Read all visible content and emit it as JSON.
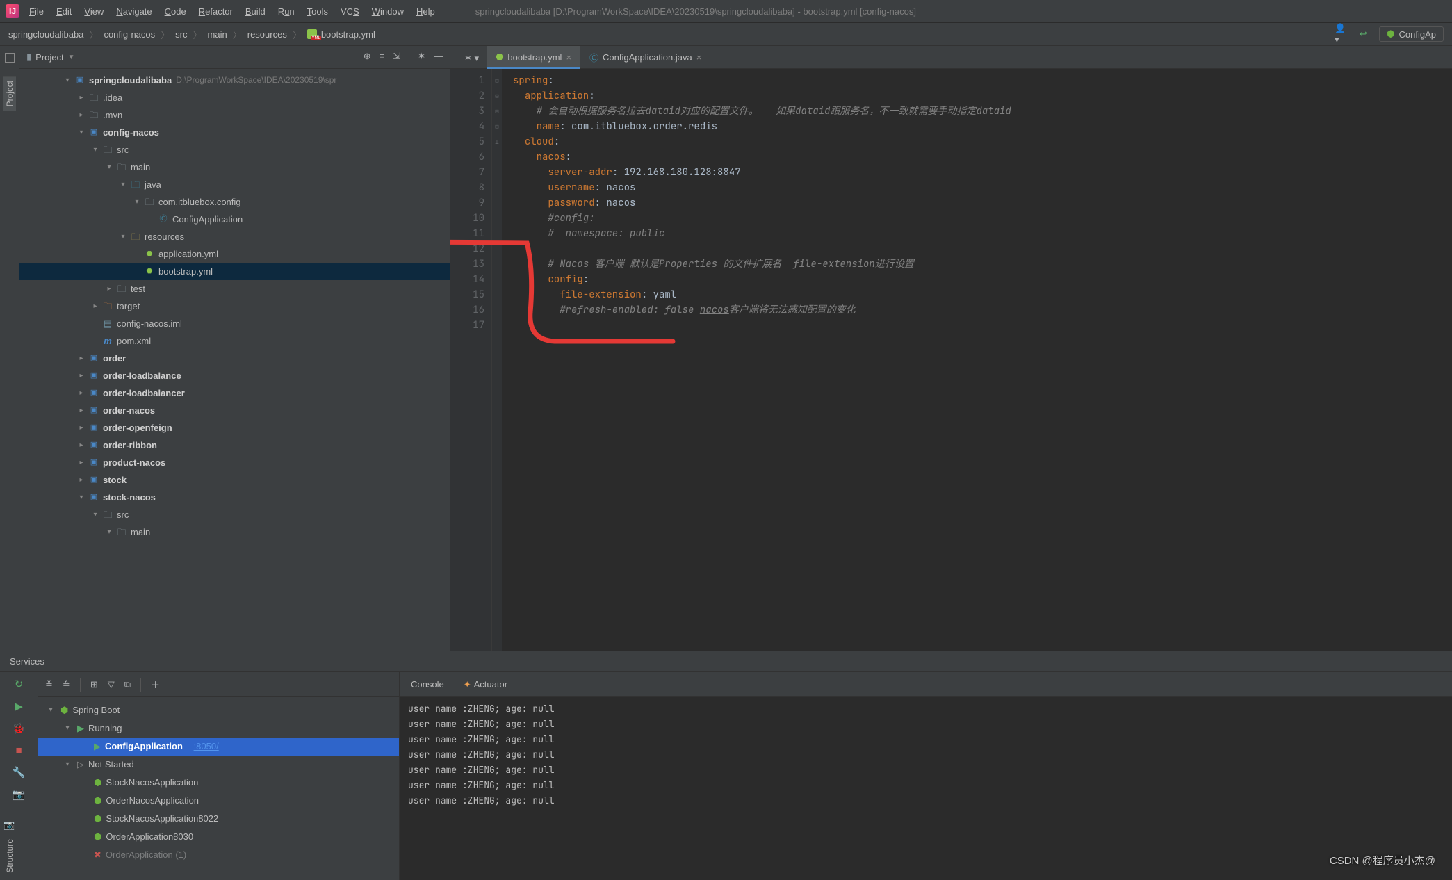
{
  "menu": {
    "items": [
      "File",
      "Edit",
      "View",
      "Navigate",
      "Code",
      "Refactor",
      "Build",
      "Run",
      "Tools",
      "VCS",
      "Window",
      "Help"
    ],
    "title": "springcloudalibaba [D:\\ProgramWorkSpace\\IDEA\\20230519\\springcloudalibaba] - bootstrap.yml [config-nacos]"
  },
  "breadcrumb": [
    "springcloudalibaba",
    "config-nacos",
    "src",
    "main",
    "resources",
    "bootstrap.yml"
  ],
  "run_config": "ConfigAp",
  "project_panel": {
    "title": "Project"
  },
  "tree": {
    "root": "springcloudalibaba",
    "root_path": "D:\\ProgramWorkSpace\\IDEA\\20230519\\spr",
    "nodes": [
      ".idea",
      ".mvn",
      "config-nacos",
      "src",
      "main",
      "java",
      "com.itbluebox.config",
      "ConfigApplication",
      "resources",
      "application.yml",
      "bootstrap.yml",
      "test",
      "target",
      "config-nacos.iml",
      "pom.xml",
      "order",
      "order-loadbalance",
      "order-loadbalancer",
      "order-nacos",
      "order-openfeign",
      "order-ribbon",
      "product-nacos",
      "stock",
      "stock-nacos",
      "src",
      "main"
    ]
  },
  "tabs": [
    {
      "label": "bootstrap.yml",
      "active": true
    },
    {
      "label": "ConfigApplication.java",
      "active": false
    }
  ],
  "gutter_lines": [
    "1",
    "2",
    "3",
    "4",
    "5",
    "6",
    "7",
    "8",
    "9",
    "10",
    "11",
    "12",
    "13",
    "14",
    "15",
    "16",
    "17"
  ],
  "code": {
    "l1a": "spring",
    "l1b": ":",
    "l2a": "application",
    "l2b": ":",
    "l3a": "# 会自动根据服务名拉去",
    "l3b": "dataid",
    "l3c": "对应的配置文件。   如果",
    "l3d": "dataid",
    "l3e": "跟服务名，不一致就需要手动指定",
    "l3f": "dataid",
    "l4a": "name",
    "l4b": ": com.itbluebox.order.redis",
    "l5a": "cloud",
    "l5b": ":",
    "l6a": "nacos",
    "l6b": ":",
    "l7a": "server-addr",
    "l7b": ": 192.168.180.128:8847",
    "l8a": "username",
    "l8b": ": nacos",
    "l9a": "password",
    "l9b": ": nacos",
    "l10": "#config:",
    "l11": "#  namespace: public",
    "l13a": "# ",
    "l13b": "Nacos",
    "l13c": " 客户端 默认是Properties 的文件扩展名  file-extension进行设置",
    "l14a": "config",
    "l14b": ":",
    "l15a": "file-extension",
    "l15b": ": yaml",
    "l16a": "#refresh-enabled: false ",
    "l16b": "nacos",
    "l16c": "客户端将无法感知配置的变化"
  },
  "services": {
    "title": "Services",
    "console_tab": "Console",
    "actuator_tab": "Actuator",
    "root": "Spring Boot",
    "running": "Running",
    "running_app": "ConfigApplication",
    "running_port": ":8050/",
    "not_started": "Not Started",
    "apps": [
      "StockNacosApplication",
      "OrderNacosApplication",
      "StockNacosApplication8022",
      "OrderApplication8030",
      "OrderApplication (1)"
    ]
  },
  "console_lines": [
    "user name :ZHENG; age: null",
    "user name :ZHENG; age: null",
    "user name :ZHENG; age: null",
    "user name :ZHENG; age: null",
    "user name :ZHENG; age: null",
    "user name :ZHENG; age: null",
    "user name :ZHENG; age: null"
  ],
  "structure_label": "Structure",
  "watermark": "CSDN @程序员小杰@",
  "chart_data": {
    "type": "table",
    "title": "bootstrap.yml",
    "data": {
      "spring": {
        "application": {
          "name": "com.itbluebox.order.redis"
        },
        "cloud": {
          "nacos": {
            "server-addr": "192.168.180.128:8847",
            "username": "nacos",
            "password": "nacos",
            "config": {
              "file-extension": "yaml"
            }
          }
        }
      }
    }
  }
}
